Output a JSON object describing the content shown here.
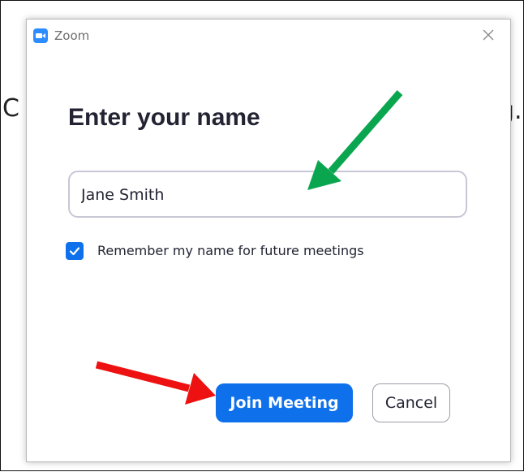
{
  "background": {
    "left_fragment": "C",
    "right_fragment": "g."
  },
  "window": {
    "app_name": "Zoom",
    "close_icon": "close-icon",
    "app_icon": "zoom-camera-icon"
  },
  "dialog": {
    "heading": "Enter your name",
    "name_input": {
      "value": "Jane Smith",
      "placeholder": ""
    },
    "remember_checkbox": {
      "checked": true,
      "label": "Remember my name for future meetings"
    },
    "buttons": {
      "join_label": "Join Meeting",
      "cancel_label": "Cancel"
    }
  },
  "annotations": {
    "green_arrow_color": "#0aa64f",
    "red_arrow_color": "#ee1111"
  },
  "colors": {
    "accent": "#0e71eb",
    "zoom_brand": "#2d8cff",
    "text": "#232333"
  }
}
